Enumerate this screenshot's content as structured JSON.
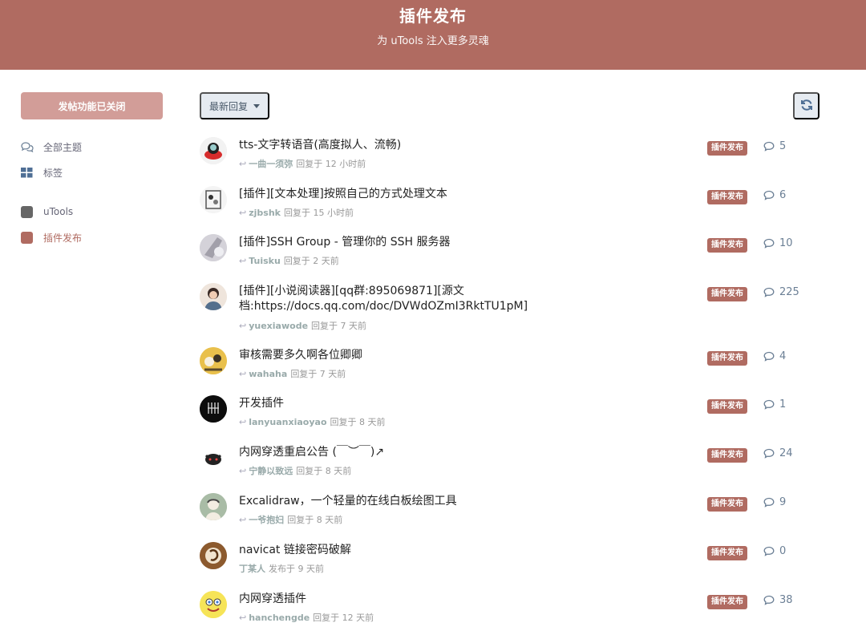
{
  "hero": {
    "title": "插件发布",
    "subtitle": "为 uTools 注入更多灵魂"
  },
  "sidebar": {
    "start_button": "发帖功能已关闭",
    "items": [
      {
        "label": "全部主题",
        "icon": "comments-icon"
      },
      {
        "label": "标签",
        "icon": "tags-grid-icon"
      },
      {
        "label": "uTools",
        "icon": "tag-square-icon",
        "color": "#666666"
      },
      {
        "label": "插件发布",
        "icon": "tag-square-icon",
        "color": "#b06b61"
      }
    ]
  },
  "toolbar": {
    "sort_label": "最新回复",
    "refresh_icon": "refresh-icon"
  },
  "colors": {
    "accent": "#b06b61",
    "button_disabled": "#d29d98",
    "tag_bg": "#b06b61"
  },
  "discussions": [
    {
      "title": "tts-文字转语音(高度拟人、流畅)",
      "user": "一曲一须弥",
      "action": "回复于 12 小时前",
      "tag": "插件发布",
      "replies": "5"
    },
    {
      "title": "[插件][文本处理]按照自己的方式处理文本",
      "user": "zjbshk",
      "action": "回复于 15 小时前",
      "tag": "插件发布",
      "replies": "6"
    },
    {
      "title": "[插件]SSH Group - 管理你的 SSH 服务器",
      "user": "Tuisku",
      "action": "回复于 2 天前",
      "tag": "插件发布",
      "replies": "10"
    },
    {
      "title": "[插件][小说阅读器][qq群:895069871][源文档:https://docs.qq.com/doc/DVWdOZmI3RktTU1pM]",
      "user": "yuexiawode",
      "action": "回复于 7 天前",
      "tag": "插件发布",
      "replies": "225"
    },
    {
      "title": "审核需要多久啊各位卿卿",
      "user": "wahaha",
      "action": "回复于 7 天前",
      "tag": "插件发布",
      "replies": "4"
    },
    {
      "title": "开发插件",
      "user": "lanyuanxiaoyao",
      "action": "回复于 8 天前",
      "tag": "插件发布",
      "replies": "1"
    },
    {
      "title": "内网穿透重启公告 (￣︶￣)↗",
      "user": "宁静以致远",
      "action": "回复于 8 天前",
      "tag": "插件发布",
      "replies": "24"
    },
    {
      "title": "Excalidraw，一个轻量的在线白板绘图工具",
      "user": "一爷抱妇",
      "action": "回复于 8 天前",
      "tag": "插件发布",
      "replies": "9"
    },
    {
      "title": "navicat 链接密码破解",
      "user": "丁某人",
      "action": "发布于 9 天前",
      "tag": "插件发布",
      "replies": "0"
    },
    {
      "title": "内网穿透插件",
      "user": "hanchengde",
      "action": "回复于 12 天前",
      "tag": "插件发布",
      "replies": "38"
    }
  ]
}
